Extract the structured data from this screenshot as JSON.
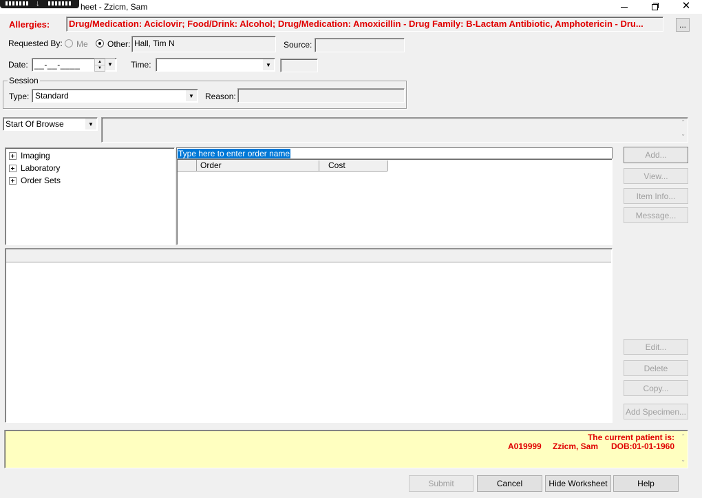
{
  "window": {
    "title": "heet - Zzicm, Sam",
    "min_icon": "minimize-icon",
    "max_icon": "restore-icon",
    "close_icon": "close-icon"
  },
  "allergies": {
    "label": "Allergies:",
    "text": "Drug/Medication: Aciclovir; Food/Drink: Alcohol; Drug/Medication: Amoxicillin - Drug Family: B-Lactam Antibiotic, Amphotericin - Dru...",
    "more_button": "...",
    "color": "#e00000"
  },
  "requested_by": {
    "label": "Requested By:",
    "me_label": "Me",
    "other_label": "Other:",
    "other_value": "Hall, Tim N",
    "selected": "Other"
  },
  "source": {
    "label": "Source:",
    "value": ""
  },
  "date": {
    "label": "Date:",
    "value": "__-__-____"
  },
  "time": {
    "label": "Time:",
    "value": ""
  },
  "session": {
    "group_label": "Session",
    "type_label": "Type:",
    "type_value": "Standard",
    "reason_label": "Reason:",
    "reason_value": ""
  },
  "browse": {
    "selected": "Start Of Browse"
  },
  "tree": {
    "items": [
      {
        "label": "Imaging"
      },
      {
        "label": "Laboratory"
      },
      {
        "label": "Order Sets"
      }
    ]
  },
  "order_entry": {
    "placeholder": "Type here to enter order name",
    "columns": [
      "",
      "Order",
      "Cost"
    ]
  },
  "buttons": {
    "add": "Add...",
    "view": "View...",
    "item_info": "Item Info...",
    "message": "Message...",
    "edit": "Edit...",
    "delete": "Delete",
    "copy": "Copy...",
    "add_specimen": "Add Specimen..."
  },
  "patient": {
    "heading": "The current patient is:",
    "id": "A019999",
    "name": "Zzicm, Sam",
    "dob": "DOB:01-01-1960",
    "color": "#e00000"
  },
  "footer": {
    "submit": "Submit",
    "cancel": "Cancel",
    "hide_worksheet": "Hide Worksheet",
    "help": "Help"
  }
}
